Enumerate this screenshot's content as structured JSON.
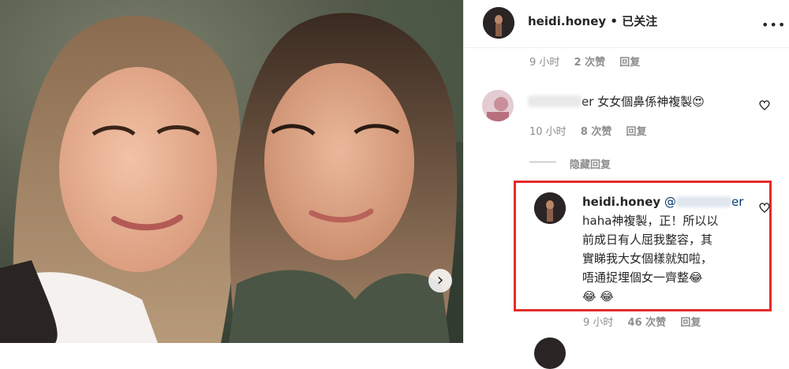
{
  "post_author": {
    "username": "heidi.honey",
    "follow_status": "已关注",
    "separator": "•",
    "more_glyph": "•••"
  },
  "photo_nav": {
    "next_glyph": "›"
  },
  "comments": [
    {
      "meta": {
        "time": "9 小时",
        "likes": "2 次赞",
        "reply": "回复"
      }
    },
    {
      "username_suffix": "er",
      "text": "女女個鼻係神複製",
      "emoji": "😍",
      "meta": {
        "time": "10 小时",
        "likes": "8 次赞",
        "reply": "回复"
      },
      "hide_replies": "隐藏回复",
      "reply": {
        "username": "heidi.honey",
        "mention_suffix": "er",
        "lines": [
          "haha神複製，正！所以以",
          "前成日有人屈我整容，其",
          "實睇我大女個樣就知啦，",
          "唔通捉埋個女一齊整"
        ],
        "emoji_inline": "😂",
        "emoji_line": "😂 😂",
        "meta": {
          "time": "9 小时",
          "likes": "46 次赞",
          "reply": "回复"
        }
      }
    }
  ],
  "colors": {
    "highlight_box": "#e52b2b",
    "text": "#262626",
    "muted": "#8e8e8e",
    "mention": "#00376b"
  }
}
